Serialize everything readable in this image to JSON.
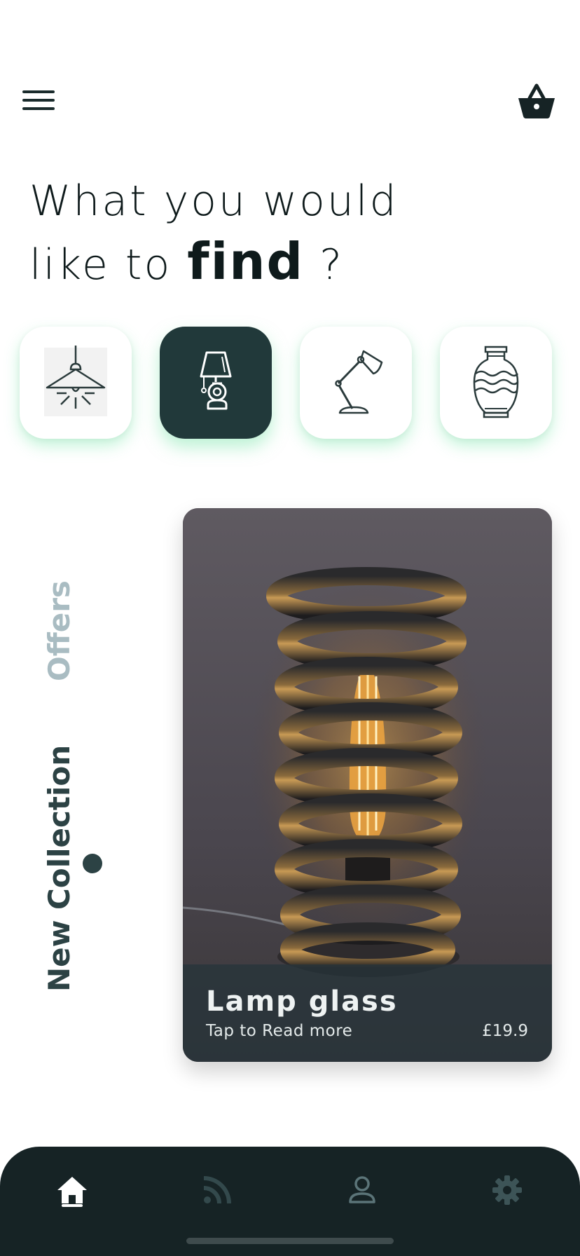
{
  "header": {
    "menu_icon": "hamburger-menu-icon",
    "cart_icon": "shopping-basket-icon"
  },
  "headline": {
    "line1": "What you would",
    "line2_prefix": "like to ",
    "line2_bold": "find",
    "line2_suffix": " ?"
  },
  "categories": [
    {
      "name": "Ceiling lamps",
      "icon": "ceiling-lamp-icon",
      "active": false
    },
    {
      "name": "Table lamps",
      "icon": "table-lamp-icon",
      "active": true
    },
    {
      "name": "Desk lamps",
      "icon": "desk-lamp-icon",
      "active": false
    },
    {
      "name": "Vases",
      "icon": "vase-icon",
      "active": false
    }
  ],
  "tabs": {
    "offers_label": "Offers",
    "new_collection_label": "New Collection",
    "selected": "New Collection"
  },
  "product": {
    "name": "Lamp glass",
    "subtitle": "Tap to Read more",
    "price": "£19.9"
  },
  "bottom_nav": {
    "items": [
      {
        "icon": "home-icon",
        "active": true
      },
      {
        "icon": "rss-feed-icon",
        "active": false
      },
      {
        "icon": "profile-icon",
        "active": false
      },
      {
        "icon": "settings-gear-icon",
        "active": false
      }
    ]
  },
  "colors": {
    "primary_dark": "#162325",
    "active_card": "#21393a",
    "accent_glow": "#7ae6aa",
    "inactive_tab": "#a9bcc2"
  }
}
